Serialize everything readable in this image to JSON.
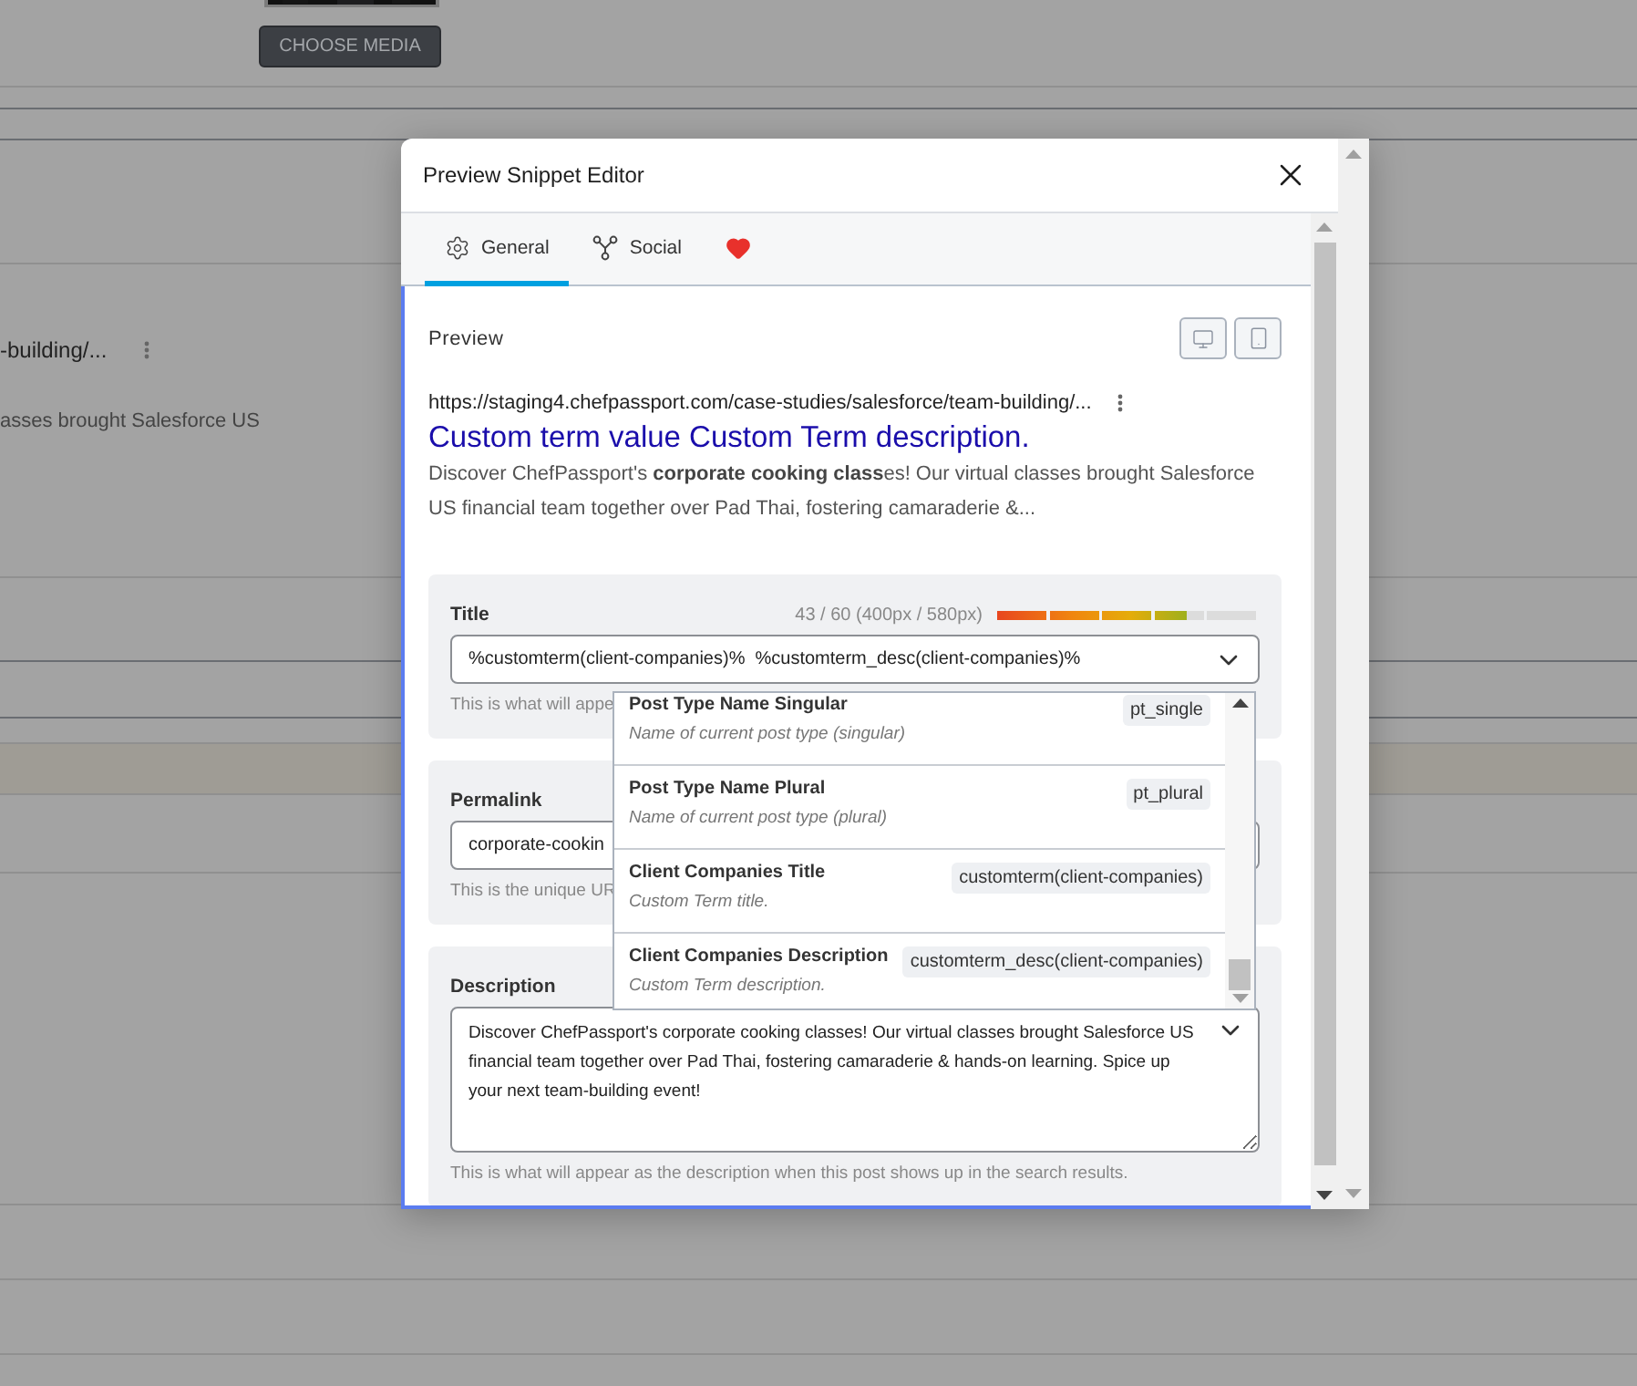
{
  "background": {
    "button": "CHOOSE MEDIA",
    "url_fragment": "-building/...",
    "snippet_fragment": "asses brought Salesforce US"
  },
  "dialog": {
    "title": "Preview Snippet Editor",
    "tabs": [
      {
        "kind": "gear",
        "label": "General",
        "selected": true
      },
      {
        "kind": "social",
        "label": "Social",
        "selected": false
      },
      {
        "kind": "heart",
        "selected": false
      }
    ],
    "preview": {
      "heading": "Preview",
      "url": "https://staging4.chefpassport.com/case-studies/salesforce/team-building/...",
      "title": "Custom term value Custom Term description.",
      "snippet": "Discover ChefPassport's **corporate cooking class**es! Our virtual classes brought Salesforce US financial team together over Pad Thai, fostering camaraderie &..."
    },
    "title_field": {
      "label": "Title",
      "counter": "43 / 60 (400px / 580px)",
      "level": 0.72,
      "value": "%customterm(client-companies)%  %customterm_desc(client-companies)%",
      "hint": "This is what will appe"
    },
    "permalink_field": {
      "label": "Permalink",
      "value": "corporate-cookin",
      "hint": "This is the unique UR"
    },
    "description_field": {
      "label": "Description",
      "value": "Discover ChefPassport's corporate cooking classes! Our virtual classes brought Salesforce US financial team together over Pad Thai, fostering camaraderie & hands-on learning. Spice up your next team-building event!",
      "hint": "This is what will appear as the description when this post shows up in the search results."
    },
    "variables": [
      {
        "name": "Post Type Name Singular",
        "description": "Name of current post type (singular)",
        "tag": "pt_single"
      },
      {
        "name": "Post Type Name Plural",
        "description": "Name of current post type (plural)",
        "tag": "pt_plural"
      },
      {
        "name": "Client Companies Title",
        "description": "Custom Term title.",
        "tag": "customterm(client-companies)"
      },
      {
        "name": "Client Companies Description",
        "description": "Custom Term description.",
        "tag": "customterm_desc(client-companies)"
      }
    ]
  }
}
